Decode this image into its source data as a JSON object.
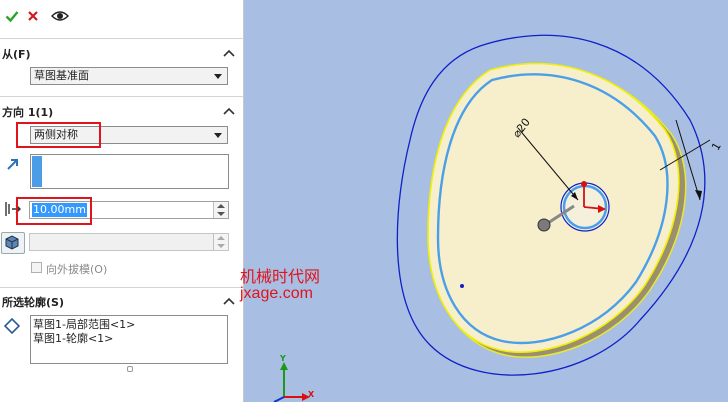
{
  "toolbar": {
    "ok_icon": "checkmark-icon",
    "cancel_icon": "x-icon",
    "preview_icon": "eye-icon",
    "ok_color": "#2aa32a",
    "cancel_color": "#d11a1a"
  },
  "from_section": {
    "title": "从(F)",
    "selected": "草图基准面"
  },
  "direction_section": {
    "title": "方向 1(1)",
    "end_condition": "两侧对称",
    "depth_value": "10.00mm",
    "draft_label": "向外拔模(O)"
  },
  "contours_section": {
    "title": "所选轮廓(S)",
    "items": [
      "草图1-局部范围<1>",
      "草图1-轮廓<1>"
    ]
  },
  "viewport": {
    "diameter_label": "⌀20",
    "dimension_partial": "1",
    "watermark_line1": "机械时代网",
    "watermark_line2": "jxage.com",
    "background": "#a8bfe3",
    "axis_x_label": "X",
    "axis_y_label": "Y"
  }
}
